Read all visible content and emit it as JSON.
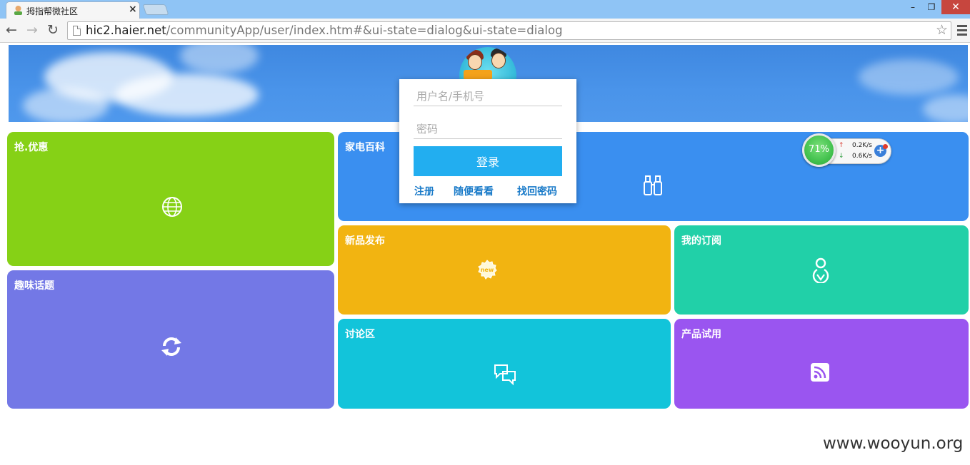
{
  "browser": {
    "tab_title": "拇指帮微社区",
    "url_host": "hic2.haier.net",
    "url_path": "/communityApp/user/index.htm#&ui-state=dialog&ui-state=dialog",
    "tab_close": "×",
    "win_min": "–",
    "win_max": "❐",
    "win_close": "✕"
  },
  "tiles": {
    "youhui": "抢.优惠",
    "quwei": "趣味话题",
    "baike": "家电百科",
    "xinpin": "新品发布",
    "dingyue": "我的订阅",
    "taolun": "讨论区",
    "shiyong": "产品试用",
    "new_badge": "new"
  },
  "login": {
    "username_placeholder": "用户名/手机号",
    "password_placeholder": "密码",
    "submit": "登录",
    "register": "注册",
    "browse": "随便看看",
    "forgot": "找回密码"
  },
  "speed_widget": {
    "percent": "71%",
    "upload": "0.2K/s",
    "download": "0.6K/s"
  },
  "watermark": "www.wooyun.org",
  "colors": {
    "youhui": "#86d116",
    "quwei": "#7378e6",
    "baike": "#3a8ff0",
    "xinpin": "#f2b411",
    "dingyue": "#21d0a8",
    "taolun": "#12c4da",
    "shiyong": "#9a55f0",
    "login_button": "#22aef0"
  },
  "icons": {
    "youhui": "globe-icon",
    "quwei": "refresh-icon",
    "baike": "binoculars-icon",
    "xinpin": "new-badge-icon",
    "dingyue": "user-icon",
    "taolun": "chat-icon",
    "shiyong": "rss-icon"
  }
}
